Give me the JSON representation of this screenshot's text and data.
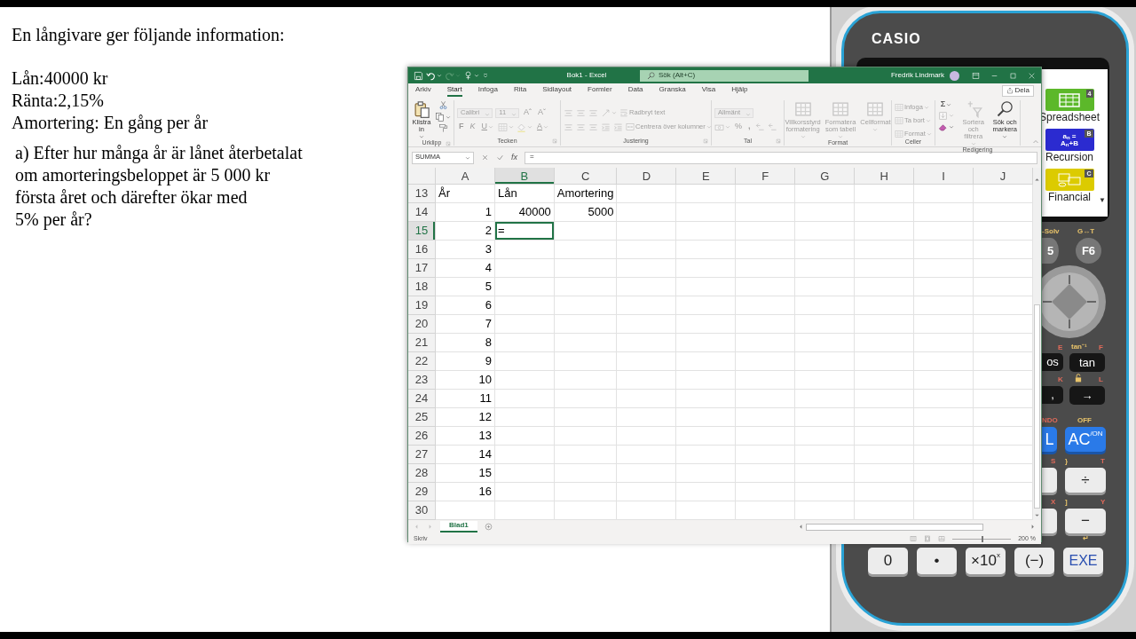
{
  "question_text": {
    "heading": "En långivare ger följande information:",
    "facts": [
      "Lån:40000 kr",
      "Ränta:2,15%",
      "Amortering: En gång per år"
    ],
    "question": "a) Efter hur många år är lånet återbetalat\nom amorteringsbeloppet är 5 000 kr\nförsta året och därefter ökar med\n5% per år?"
  },
  "excel": {
    "title": "Bok1 - Excel",
    "search": {
      "placeholder": "Sök (Alt+C)"
    },
    "user": "Fredrik Lindmark",
    "quick_access": [
      {
        "dropdown": false,
        "disabled": false
      },
      {
        "dropdown": true,
        "disabled": false
      },
      {
        "dropdown": true,
        "disabled": true
      },
      {
        "dropdown": true,
        "disabled": false
      },
      {
        "dropdown": false,
        "disabled": false
      }
    ],
    "tabs": [
      {
        "label": "Arkiv",
        "selected": false
      },
      {
        "label": "Start",
        "selected": true
      },
      {
        "label": "Infoga",
        "selected": false
      },
      {
        "label": "Rita",
        "selected": false
      },
      {
        "label": "Sidlayout",
        "selected": false
      },
      {
        "label": "Formler",
        "selected": false
      },
      {
        "label": "Data",
        "selected": false
      },
      {
        "label": "Granska",
        "selected": false
      },
      {
        "label": "Visa",
        "selected": false
      },
      {
        "label": "Hjälp",
        "selected": false
      }
    ],
    "share_button": "Dela",
    "ribbon": [
      {
        "label": "Urklipp",
        "launcher": true,
        "items": [
          [
            {
              "kind": "large",
              "label": "Klistra\nin",
              "dropdown": true,
              "disabled": false
            }
          ],
          [
            {
              "kind": "icon",
              "dropdown": false,
              "disabled": false
            },
            {
              "kind": "icon",
              "dropdown": true,
              "disabled": false
            },
            {
              "kind": "icon",
              "dropdown": false,
              "disabled": false
            }
          ]
        ]
      },
      {
        "label": "Tecken",
        "launcher": true,
        "items": [
          [
            {
              "kind": "combo",
              "label": "Calibri",
              "disabled": true
            },
            {
              "kind": "combo",
              "label": "11",
              "disabled": true
            },
            {
              "kind": "glyph",
              "label": "Aˆ",
              "dropdown": false,
              "disabled": true
            },
            {
              "kind": "glyph",
              "label": "Aˇ",
              "dropdown": false,
              "disabled": true
            }
          ],
          [
            {
              "kind": "glyph",
              "label": "F",
              "dropdown": false,
              "disabled": true
            },
            {
              "kind": "glyph",
              "label": "K",
              "dropdown": false,
              "disabled": true
            },
            {
              "kind": "glyph",
              "label": "U",
              "dropdown": true,
              "disabled": true
            },
            {
              "kind": "icon",
              "dropdown": true,
              "disabled": true
            },
            {
              "kind": "icon",
              "dropdown": true,
              "disabled": true
            },
            {
              "kind": "glyph",
              "label": "A",
              "dropdown": true,
              "disabled": true
            }
          ]
        ]
      },
      {
        "label": "Justering",
        "launcher": true,
        "items": [
          [
            {
              "kind": "icon",
              "dropdown": false,
              "disabled": true
            },
            {
              "kind": "icon",
              "dropdown": false,
              "disabled": true
            },
            {
              "kind": "icon",
              "dropdown": false,
              "disabled": true
            },
            {
              "kind": "icon",
              "dropdown": true,
              "disabled": true
            },
            {
              "kind": "small",
              "label": "Radbryt text",
              "dropdown": false,
              "disabled": true
            }
          ],
          [
            {
              "kind": "icon",
              "dropdown": false,
              "disabled": true
            },
            {
              "kind": "icon",
              "dropdown": false,
              "disabled": true
            },
            {
              "kind": "icon",
              "dropdown": false,
              "disabled": true
            },
            {
              "kind": "icon",
              "dropdown": false,
              "disabled": true
            },
            {
              "kind": "icon",
              "dropdown": false,
              "disabled": true
            },
            {
              "kind": "small",
              "label": "Centrera över kolumner",
              "dropdown": true,
              "disabled": true
            }
          ]
        ]
      },
      {
        "label": "Tal",
        "launcher": true,
        "items": [
          [
            {
              "kind": "combo",
              "label": "Allmänt",
              "disabled": true
            }
          ],
          [
            {
              "kind": "icon",
              "dropdown": true,
              "disabled": true
            },
            {
              "kind": "glyph",
              "label": "%",
              "dropdown": false,
              "disabled": true
            },
            {
              "kind": "glyph",
              "label": ",",
              "dropdown": false,
              "disabled": true
            },
            {
              "kind": "icon",
              "dropdown": false,
              "disabled": true
            },
            {
              "kind": "icon",
              "dropdown": false,
              "disabled": true
            }
          ]
        ]
      },
      {
        "label": "Format",
        "launcher": false,
        "items": [
          [
            {
              "kind": "large",
              "label": "Villkorsstyrd\nformatering",
              "dropdown": true,
              "disabled": true
            }
          ],
          [
            {
              "kind": "large",
              "label": "Formatera\nsom tabell",
              "dropdown": true,
              "disabled": true
            }
          ],
          [
            {
              "kind": "large",
              "label": "Cellformat",
              "dropdown": true,
              "disabled": true
            }
          ]
        ]
      },
      {
        "label": "Celler",
        "launcher": false,
        "items": [
          [
            {
              "kind": "small",
              "label": "Infoga",
              "dropdown": true,
              "disabled": true
            }
          ],
          [
            {
              "kind": "small",
              "label": "Ta bort",
              "dropdown": true,
              "disabled": true
            }
          ],
          [
            {
              "kind": "small",
              "label": "Format",
              "dropdown": true,
              "disabled": true
            }
          ]
        ]
      },
      {
        "label": "Redigering",
        "launcher": false,
        "items": [
          [
            {
              "kind": "glyph",
              "label": "Σ",
              "dropdown": true,
              "disabled": false
            },
            {
              "kind": "icon",
              "dropdown": true,
              "disabled": true
            },
            {
              "kind": "icon",
              "dropdown": true,
              "disabled": false
            }
          ],
          [
            {
              "kind": "large",
              "label": "Sortera och\nfiltrera",
              "dropdown": true,
              "disabled": true
            }
          ],
          [
            {
              "kind": "large",
              "label": "Sök och\nmarkera",
              "dropdown": true,
              "disabled": false
            }
          ]
        ]
      }
    ],
    "formula_bar": {
      "name_box": "SUMMA",
      "function_button": "fx",
      "formula": "="
    },
    "sheet": {
      "columns": [
        {
          "label": "A",
          "selected": false
        },
        {
          "label": "B",
          "selected": true
        },
        {
          "label": "C",
          "selected": false
        },
        {
          "label": "D",
          "selected": false
        },
        {
          "label": "E",
          "selected": false
        },
        {
          "label": "F",
          "selected": false
        },
        {
          "label": "G",
          "selected": false
        },
        {
          "label": "H",
          "selected": false
        },
        {
          "label": "I",
          "selected": false
        },
        {
          "label": "J",
          "selected": false
        }
      ],
      "rows": [
        {
          "label": "13",
          "selected": false,
          "cells": [
            {
              "text": "År",
              "kind": "text",
              "selected": false
            },
            {
              "text": "Lån",
              "kind": "text",
              "selected": false
            },
            {
              "text": "Amortering",
              "kind": "text",
              "selected": false
            }
          ]
        },
        {
          "label": "14",
          "selected": false,
          "cells": [
            {
              "text": "1",
              "kind": "number",
              "selected": false
            },
            {
              "text": "40000",
              "kind": "number",
              "selected": false
            },
            {
              "text": "5000",
              "kind": "number",
              "selected": false
            }
          ]
        },
        {
          "label": "15",
          "selected": true,
          "cells": [
            {
              "text": "2",
              "kind": "number",
              "selected": false
            },
            {
              "text": "=",
              "kind": "text",
              "selected": true
            }
          ]
        },
        {
          "label": "16",
          "selected": false,
          "cells": [
            {
              "text": "3",
              "kind": "number",
              "selected": false
            }
          ]
        },
        {
          "label": "17",
          "selected": false,
          "cells": [
            {
              "text": "4",
              "kind": "number",
              "selected": false
            }
          ]
        },
        {
          "label": "18",
          "selected": false,
          "cells": [
            {
              "text": "5",
              "kind": "number",
              "selected": false
            }
          ]
        },
        {
          "label": "19",
          "selected": false,
          "cells": [
            {
              "text": "6",
              "kind": "number",
              "selected": false
            }
          ]
        },
        {
          "label": "20",
          "selected": false,
          "cells": [
            {
              "text": "7",
              "kind": "number",
              "selected": false
            }
          ]
        },
        {
          "label": "21",
          "selected": false,
          "cells": [
            {
              "text": "8",
              "kind": "number",
              "selected": false
            }
          ]
        },
        {
          "label": "22",
          "selected": false,
          "cells": [
            {
              "text": "9",
              "kind": "number",
              "selected": false
            }
          ]
        },
        {
          "label": "23",
          "selected": false,
          "cells": [
            {
              "text": "10",
              "kind": "number",
              "selected": false
            }
          ]
        },
        {
          "label": "24",
          "selected": false,
          "cells": [
            {
              "text": "11",
              "kind": "number",
              "selected": false
            }
          ]
        },
        {
          "label": "25",
          "selected": false,
          "cells": [
            {
              "text": "12",
              "kind": "number",
              "selected": false
            }
          ]
        },
        {
          "label": "26",
          "selected": false,
          "cells": [
            {
              "text": "13",
              "kind": "number",
              "selected": false
            }
          ]
        },
        {
          "label": "27",
          "selected": false,
          "cells": [
            {
              "text": "14",
              "kind": "number",
              "selected": false
            }
          ]
        },
        {
          "label": "28",
          "selected": false,
          "cells": [
            {
              "text": "15",
              "kind": "number",
              "selected": false
            }
          ]
        },
        {
          "label": "29",
          "selected": false,
          "cells": [
            {
              "text": "16",
              "kind": "number",
              "selected": false
            }
          ]
        },
        {
          "label": "30",
          "selected": false,
          "cells": []
        }
      ]
    },
    "sheet_tabs": [
      {
        "label": "Blad1",
        "selected": true
      }
    ],
    "status": "Skriv",
    "zoom": {
      "level": 0.5,
      "reading": "200 %"
    }
  },
  "calculator": {
    "brand": "CASIO",
    "menu": [
      {
        "label": "Spreadsheet",
        "badge": "4",
        "color": "#5cb82a",
        "kind": "grid"
      },
      {
        "label": "Recursion",
        "badge": "B",
        "color": "#2b2bd0",
        "kind": "formula",
        "icon_lines": [
          "a$_{n}$ =",
          "A$_{n}$+B"
        ]
      },
      {
        "label": "Financial",
        "badge": "C",
        "color": "#dccb00",
        "kind": "money"
      }
    ],
    "scroll_arrow": "▼",
    "labels": [
      {
        "text": "-Solv",
        "kind": "shift"
      },
      {
        "text": "G↔T",
        "kind": "shift"
      },
      {
        "text": "E",
        "kind": "alpha"
      },
      {
        "text": "tan⁻¹",
        "kind": "shift"
      },
      {
        "text": "F",
        "kind": "alpha"
      },
      {
        "text": "K",
        "kind": "alpha"
      },
      {
        "text": "L",
        "kind": "alpha"
      },
      {
        "text": "NDO",
        "kind": "alpha"
      },
      {
        "text": "OFF",
        "kind": "shift"
      },
      {
        "text": "S",
        "kind": "alpha"
      },
      {
        "text": "}",
        "kind": "shift"
      },
      {
        "text": "T",
        "kind": "alpha"
      },
      {
        "text": "X",
        "kind": "alpha"
      },
      {
        "text": "]",
        "kind": "shift"
      },
      {
        "text": "Y",
        "kind": "alpha"
      },
      {
        "text": "↵",
        "kind": "shift"
      }
    ],
    "keys": [
      {
        "label": "5",
        "kind": "round"
      },
      {
        "label": "F6",
        "kind": "round"
      },
      {
        "label": "os",
        "kind": "dark"
      },
      {
        "label": "tan",
        "kind": "dark"
      },
      {
        "label": ",",
        "kind": "dark"
      },
      {
        "label": "→",
        "kind": "dark"
      },
      {
        "label": "L",
        "kind": "blue"
      },
      {
        "label": "AC$^{/ON}$",
        "kind": "blue"
      },
      {
        "kind": "light"
      },
      {
        "label": "÷",
        "kind": "light"
      },
      {
        "kind": "light"
      },
      {
        "label": "−",
        "kind": "light"
      },
      {
        "label": "0",
        "kind": "light"
      },
      {
        "label": "•",
        "kind": "light"
      },
      {
        "label": "×10$^{x}$",
        "kind": "light"
      },
      {
        "label": "(−)",
        "kind": "light"
      },
      {
        "label": "EXE",
        "kind": "exe"
      }
    ]
  }
}
